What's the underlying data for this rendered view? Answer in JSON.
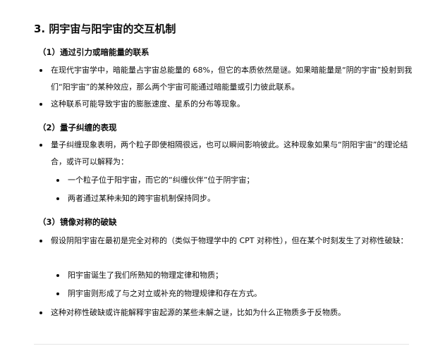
{
  "section": {
    "title": "3. 阴宇宙与阳宇宙的交互机制"
  },
  "subsections": [
    {
      "title": "（1）通过引力或暗能量的联系",
      "items": [
        "在现代宇宙学中，暗能量占宇宙总能量的 68%，但它的本质依然是谜。如果暗能量是“阴的宇宙”投射到我们“阳宇宙”的某种效应，那么两个宇宙可能通过暗能量或引力彼此联系。",
        "这种联系可能导致宇宙的膨胀速度、星系的分布等现象。"
      ]
    },
    {
      "title": "（2）量子纠缠的表现",
      "items": [
        "量子纠缠现象表明，两个粒子即使相隔很远，也可以瞬间影响彼此。这种现象如果与“阴阳宇宙”的理论结合，或许可以解释为："
      ],
      "subitems": [
        "一个粒子位于阳宇宙，而它的“纠缠伙伴”位于阴宇宙；",
        "两者通过某种未知的跨宇宙机制保持同步。"
      ]
    },
    {
      "title": "（3）镜像对称的破缺",
      "items": [
        "假设阴阳宇宙在最初是完全对称的（类似于物理学中的 CPT 对称性），但在某个时刻发生了对称性破缺："
      ],
      "subitems": [
        "阳宇宙诞生了我们所熟知的物理定律和物质；",
        "阴宇宙则形成了与之对立或补充的物理规律和存在方式。"
      ],
      "closing_item": "这种对称性破缺或许能解释宇宙起源的某些未解之谜，比如为什么正物质多于反物质。"
    }
  ]
}
